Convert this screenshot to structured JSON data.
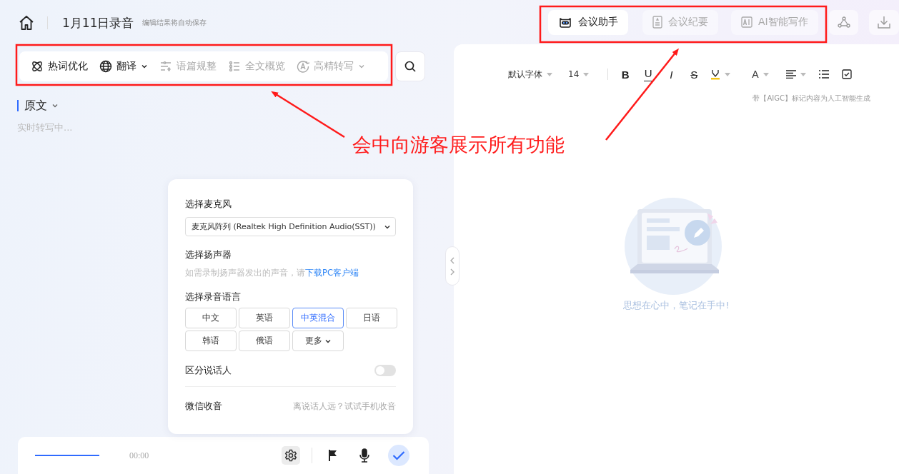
{
  "header": {
    "title": "1月11日录音",
    "subtitle": "编辑结果将自动保存"
  },
  "toolbar": {
    "items": [
      {
        "label": "热词优化",
        "disabled": false,
        "menu": false
      },
      {
        "label": "翻译",
        "disabled": false,
        "menu": true
      },
      {
        "label": "语篇规整",
        "disabled": true,
        "menu": false
      },
      {
        "label": "全文概览",
        "disabled": true,
        "menu": false
      },
      {
        "label": "高精转写",
        "disabled": true,
        "menu": true
      }
    ]
  },
  "transcript": {
    "heading": "原文",
    "status": "实时转写中..."
  },
  "device_panel": {
    "mic_label": "选择麦克风",
    "mic_value": "麦克风阵列 (Realtek High Definition Audio(SST))",
    "speaker_label": "选择扬声器",
    "speaker_hint": "如需录制扬声器发出的声音，请",
    "speaker_link": "下载PC客户端",
    "language_label": "选择录音语言",
    "languages": [
      {
        "label": "中文",
        "kind": "language",
        "selected": false
      },
      {
        "label": "英语",
        "kind": "language",
        "selected": false
      },
      {
        "label": "中英混合",
        "kind": "language",
        "selected": true
      },
      {
        "label": "日语",
        "kind": "language",
        "selected": false
      },
      {
        "label": "韩语",
        "kind": "language",
        "selected": false
      },
      {
        "label": "俄语",
        "kind": "language",
        "selected": false
      },
      {
        "label": "更多",
        "kind": "more",
        "selected": false
      }
    ],
    "diarization": {
      "label": "区分说话人",
      "on": false
    },
    "wechat": {
      "label": "微信收音",
      "hint": "离说话人远？试试手机收音"
    }
  },
  "recorder": {
    "time": "00:00"
  },
  "right_tabs": [
    {
      "label": "会议助手",
      "selected": true
    },
    {
      "label": "会议纪要",
      "selected": false
    },
    {
      "label": "AI智能写作",
      "selected": false
    }
  ],
  "editor": {
    "font": "默认字体",
    "size": "14",
    "format_buttons": [
      {
        "kind": "bold",
        "label": "B"
      },
      {
        "kind": "underline",
        "label": "U"
      },
      {
        "kind": "italic",
        "label": "I"
      },
      {
        "kind": "strike",
        "label": "S"
      }
    ],
    "font_color": "A",
    "aigc_note": "带【AIGC】标记内容为人工智能生成",
    "empty_text": "思想在心中，笔记在手中!"
  },
  "annotation": {
    "caption": "会中向游客展示所有功能"
  }
}
